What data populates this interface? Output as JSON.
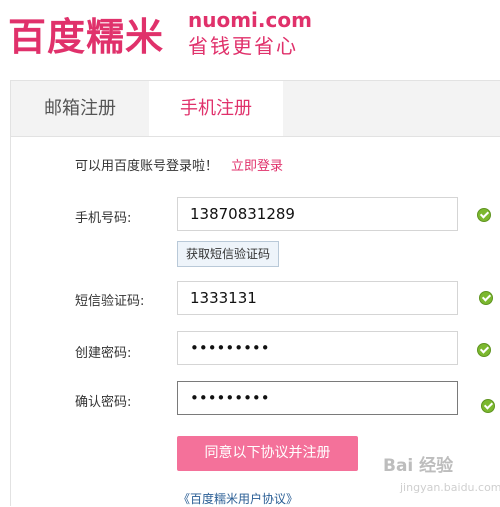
{
  "header": {
    "logo_cn": "百度糯米",
    "logo_domain": "nuomi.com",
    "slogan": "省钱更省心"
  },
  "tabs": [
    {
      "label": "邮箱注册"
    },
    {
      "label": "手机注册"
    }
  ],
  "login_hint": {
    "text": "可以用百度账号登录啦！",
    "link": "立即登录"
  },
  "form": {
    "phone": {
      "label": "手机号码:",
      "value": "13870831289"
    },
    "sms_button": "获取短信验证码",
    "sms_code": {
      "label": "短信验证码:",
      "value": "1333131"
    },
    "password": {
      "label": "创建密码:",
      "value": "•••••••••"
    },
    "confirm": {
      "label": "确认密码:",
      "value": "•••••••••"
    },
    "submit": "同意以下协议并注册",
    "agreement": "《百度糯米用户协议》"
  },
  "watermark": {
    "text": "Bai 经验",
    "sub": "jingyan.baidu.com"
  },
  "colors": {
    "brand": "#e0316b",
    "submit_bg": "#f4719a",
    "check": "#7cb82f"
  }
}
